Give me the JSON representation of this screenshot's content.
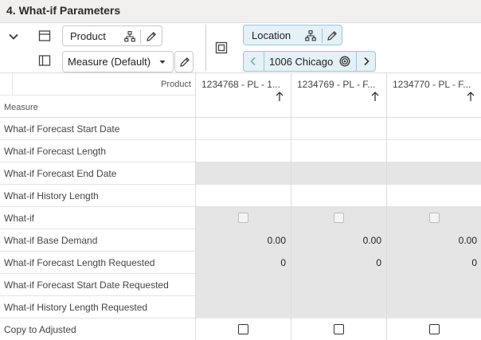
{
  "title": "4. What-if Parameters",
  "toolbar": {
    "product_label": "Product",
    "measure_label": "Measure (Default)",
    "location_label": "Location",
    "location_value": "1006 Chicago"
  },
  "grid": {
    "product_header": "Product",
    "measure_header": "Measure",
    "columns": [
      "1234768 - PL - 1...",
      "1234769 - PL - F...",
      "1234770 - PL - F..."
    ],
    "rows": [
      {
        "label": "What-if Forecast Start Date",
        "ro": false,
        "cells": [
          "",
          "",
          ""
        ]
      },
      {
        "label": "What-if Forecast Length",
        "ro": false,
        "cells": [
          "",
          "",
          ""
        ]
      },
      {
        "label": "What-if Forecast End Date",
        "ro": true,
        "cells": [
          "",
          "",
          ""
        ]
      },
      {
        "label": "What-if History Length",
        "ro": false,
        "cells": [
          "",
          "",
          ""
        ]
      },
      {
        "label": "What-if",
        "ro": true,
        "checkbox": "disabled",
        "cells": [
          "",
          "",
          ""
        ]
      },
      {
        "label": "What-if Base Demand",
        "ro": true,
        "cells": [
          "0.00",
          "0.00",
          "0.00"
        ]
      },
      {
        "label": "What-if Forecast Length Requested",
        "ro": true,
        "cells": [
          "0",
          "0",
          "0"
        ]
      },
      {
        "label": "What-if Forecast Start Date Requested",
        "ro": true,
        "cells": [
          "",
          "",
          ""
        ]
      },
      {
        "label": "What-if History Length Requested",
        "ro": true,
        "cells": [
          "",
          "",
          ""
        ]
      },
      {
        "label": "Copy to Adjusted",
        "ro": false,
        "checkbox": "active",
        "cells": [
          "",
          "",
          ""
        ]
      }
    ]
  }
}
